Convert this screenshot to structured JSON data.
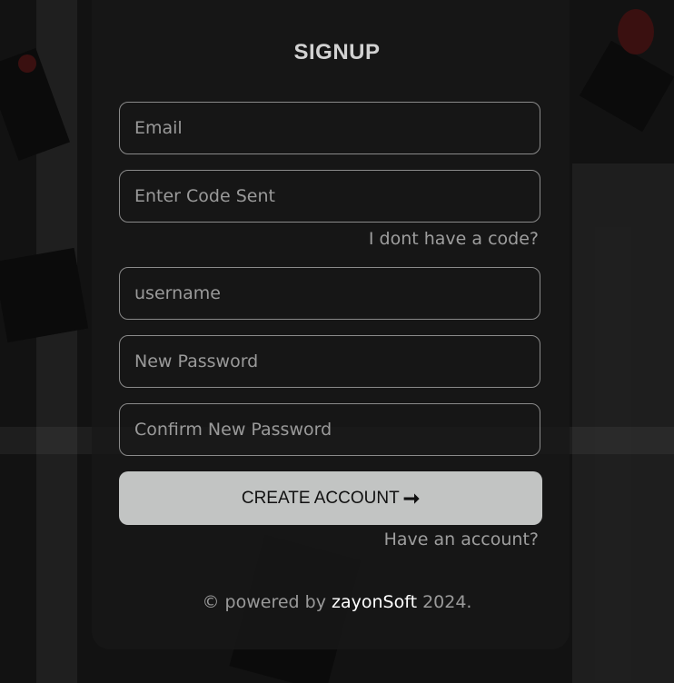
{
  "form": {
    "title": "SIGNUP",
    "email_placeholder": "Email",
    "code_placeholder": "Enter Code Sent",
    "no_code_link": "I dont have a code?",
    "username_placeholder": "username",
    "new_password_placeholder": "New Password",
    "confirm_password_placeholder": "Confirm New Password",
    "submit_label": "CREATE ACCOUNT",
    "submit_icon": "arrow-right-icon",
    "have_account_link": "Have an account?"
  },
  "footer": {
    "prefix": "© powered by",
    "brand": "zayonSoft",
    "year": "2024."
  },
  "colors": {
    "card_background": "#181818",
    "button_background": "#c2c4c3",
    "field_border": "#8a8a8a",
    "link_text": "#9e9e9e",
    "brand_text": "#ffffff"
  }
}
